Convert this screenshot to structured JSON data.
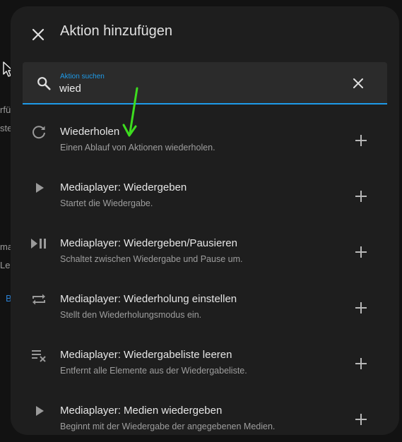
{
  "background": {
    "fragments": [
      "rfü",
      "ste",
      "ma",
      "Leu",
      "B"
    ]
  },
  "dialog": {
    "title": "Aktion hinzufügen",
    "close_icon": "close-icon"
  },
  "search": {
    "label": "Aktion suchen",
    "value": "wied",
    "icon": "search-icon",
    "clear_icon": "clear-icon"
  },
  "items": [
    {
      "title": "Wiederholen",
      "description": "Einen Ablauf von Aktionen wiederholen.",
      "icon": "repeat-icon"
    },
    {
      "title": "Mediaplayer: Wiedergeben",
      "description": "Startet die Wiedergabe.",
      "icon": "play-icon"
    },
    {
      "title": "Mediaplayer: Wiedergeben/Pausieren",
      "description": "Schaltet zwischen Wiedergabe und Pause um.",
      "icon": "play-pause-icon"
    },
    {
      "title": "Mediaplayer: Wiederholung einstellen",
      "description": "Stellt den Wiederholungsmodus ein.",
      "icon": "repeat-mode-icon"
    },
    {
      "title": "Mediaplayer: Wiedergabeliste leeren",
      "description": "Entfernt alle Elemente aus der Wiedergabeliste.",
      "icon": "playlist-remove-icon"
    },
    {
      "title": "Mediaplayer: Medien wiedergeben",
      "description": "Beginnt mit der Wiedergabe der angegebenen Medien.",
      "icon": "play-icon"
    }
  ],
  "colors": {
    "accent": "#1e9be9",
    "annotation_arrow": "#3ddc1f",
    "dialog_bg": "#1e1e1e"
  }
}
